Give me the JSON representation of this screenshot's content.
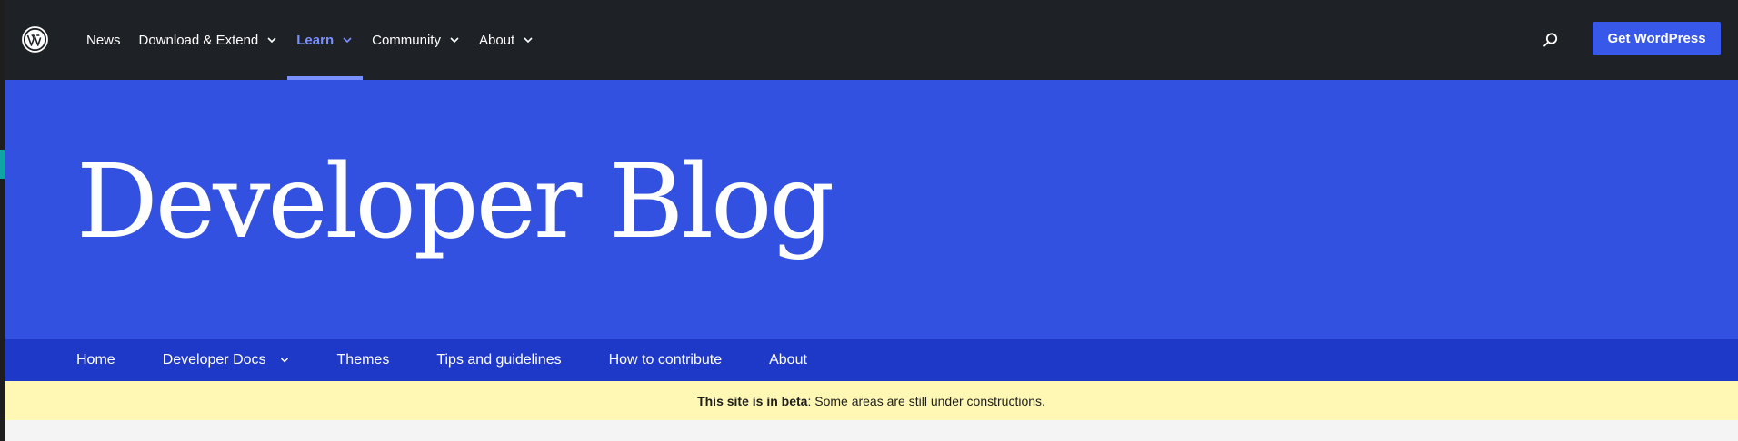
{
  "header": {
    "nav": [
      {
        "label": "News",
        "has_dropdown": false,
        "active": false
      },
      {
        "label": "Download & Extend",
        "has_dropdown": true,
        "active": false
      },
      {
        "label": "Learn",
        "has_dropdown": true,
        "active": true
      },
      {
        "label": "Community",
        "has_dropdown": true,
        "active": false
      },
      {
        "label": "About",
        "has_dropdown": true,
        "active": false
      }
    ],
    "search_icon": "search-icon",
    "cta_label": "Get WordPress"
  },
  "hero": {
    "title": "Developer Blog"
  },
  "local_nav": [
    {
      "label": "Home",
      "has_dropdown": false
    },
    {
      "label": "Developer Docs",
      "has_dropdown": true
    },
    {
      "label": "Themes",
      "has_dropdown": false
    },
    {
      "label": "Tips and guidelines",
      "has_dropdown": false
    },
    {
      "label": "How to contribute",
      "has_dropdown": false
    },
    {
      "label": "About",
      "has_dropdown": false
    }
  ],
  "banner": {
    "bold": "This site is in beta",
    "rest": ": Some areas are still under constructions."
  },
  "colors": {
    "header_bg": "#1e2125",
    "hero_bg": "#3351e0",
    "local_nav_bg": "#1e38c8",
    "accent": "#7b90ff",
    "cta_bg": "#3858e9",
    "banner_bg": "#fff8b5"
  }
}
